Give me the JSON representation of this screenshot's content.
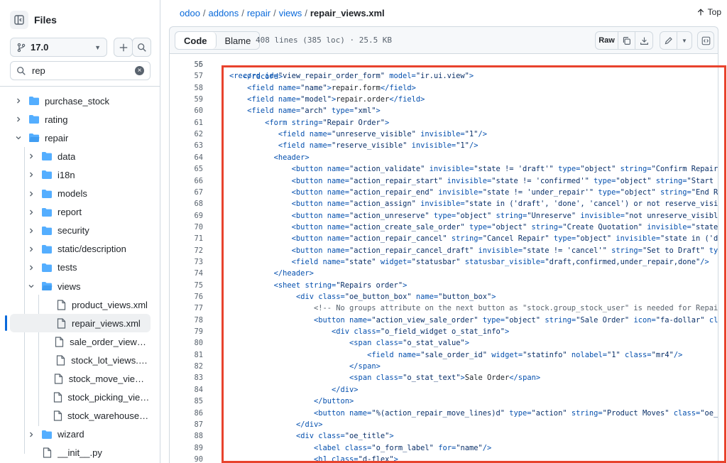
{
  "sidebar": {
    "title": "Files",
    "branch": "17.0",
    "search_value": "rep",
    "tree": [
      {
        "label": "purchase_stock",
        "type": "folder",
        "expanded": false,
        "depth": 0
      },
      {
        "label": "rating",
        "type": "folder",
        "expanded": false,
        "depth": 0
      },
      {
        "label": "repair",
        "type": "folder",
        "expanded": true,
        "depth": 0
      },
      {
        "label": "data",
        "type": "folder",
        "expanded": false,
        "depth": 1
      },
      {
        "label": "i18n",
        "type": "folder",
        "expanded": false,
        "depth": 1
      },
      {
        "label": "models",
        "type": "folder",
        "expanded": false,
        "depth": 1
      },
      {
        "label": "report",
        "type": "folder",
        "expanded": false,
        "depth": 1
      },
      {
        "label": "security",
        "type": "folder",
        "expanded": false,
        "depth": 1
      },
      {
        "label": "static/description",
        "type": "folder",
        "expanded": false,
        "depth": 1
      },
      {
        "label": "tests",
        "type": "folder",
        "expanded": false,
        "depth": 1
      },
      {
        "label": "views",
        "type": "folder",
        "expanded": true,
        "depth": 1
      },
      {
        "label": "product_views.xml",
        "type": "file",
        "depth": 2
      },
      {
        "label": "repair_views.xml",
        "type": "file",
        "depth": 2,
        "selected": true
      },
      {
        "label": "sale_order_views.xml",
        "type": "file",
        "depth": 2
      },
      {
        "label": "stock_lot_views.xml",
        "type": "file",
        "depth": 2
      },
      {
        "label": "stock_move_views.xml",
        "type": "file",
        "depth": 2
      },
      {
        "label": "stock_picking_views.xml",
        "type": "file",
        "depth": 2
      },
      {
        "label": "stock_warehouse_view...",
        "type": "file",
        "depth": 2
      },
      {
        "label": "wizard",
        "type": "folder",
        "expanded": false,
        "depth": 1
      },
      {
        "label": "__init__.py",
        "type": "file",
        "depth": 1
      }
    ]
  },
  "breadcrumb": {
    "parts": [
      "odoo",
      "addons",
      "repair",
      "views"
    ],
    "separator": "/",
    "current": "repair_views.xml"
  },
  "top_label": "Top",
  "toolbar": {
    "code_tab": "Code",
    "blame_tab": "Blame",
    "file_meta": "408 lines (385 loc) · 25.5 KB",
    "raw_label": "Raw"
  },
  "code": {
    "partial_top": "</record>",
    "lines": [
      {
        "n": "56",
        "indent": 0,
        "html": ""
      },
      {
        "n": "57",
        "indent": 4,
        "html": "<span class=\"tag\">&lt;record</span> <span class=\"attr\">id=</span><span class=\"str\">\"view_repair_order_form\"</span> <span class=\"attr\">model=</span><span class=\"str\">\"ir.ui.view\"</span><span class=\"tag\">&gt;</span>"
      },
      {
        "n": "58",
        "indent": 8,
        "html": "<span class=\"tag\">&lt;field</span> <span class=\"attr\">name=</span><span class=\"str\">\"name\"</span><span class=\"tag\">&gt;</span>repair.form<span class=\"tag\">&lt;/field&gt;</span>"
      },
      {
        "n": "59",
        "indent": 8,
        "html": "<span class=\"tag\">&lt;field</span> <span class=\"attr\">name=</span><span class=\"str\">\"model\"</span><span class=\"tag\">&gt;</span>repair.order<span class=\"tag\">&lt;/field&gt;</span>"
      },
      {
        "n": "60",
        "indent": 8,
        "html": "<span class=\"tag\">&lt;field</span> <span class=\"attr\">name=</span><span class=\"str\">\"arch\"</span> <span class=\"attr\">type=</span><span class=\"str\">\"xml\"</span><span class=\"tag\">&gt;</span>"
      },
      {
        "n": "61",
        "indent": 12,
        "html": "<span class=\"tag\">&lt;form</span> <span class=\"attr\">string=</span><span class=\"str\">\"Repair Order\"</span><span class=\"tag\">&gt;</span>"
      },
      {
        "n": "62",
        "indent": 15,
        "html": "<span class=\"tag\">&lt;field</span> <span class=\"attr\">name=</span><span class=\"str\">\"unreserve_visible\"</span> <span class=\"attr\">invisible=</span><span class=\"str\">\"1\"</span><span class=\"tag\">/&gt;</span>"
      },
      {
        "n": "63",
        "indent": 15,
        "html": "<span class=\"tag\">&lt;field</span> <span class=\"attr\">name=</span><span class=\"str\">\"reserve_visible\"</span> <span class=\"attr\">invisible=</span><span class=\"str\">\"1\"</span><span class=\"tag\">/&gt;</span>"
      },
      {
        "n": "64",
        "indent": 14,
        "html": "<span class=\"tag\">&lt;header&gt;</span>"
      },
      {
        "n": "65",
        "indent": 18,
        "html": "<span class=\"tag\">&lt;button</span> <span class=\"attr\">name=</span><span class=\"str\">\"action_validate\"</span> <span class=\"attr\">invisible=</span><span class=\"str\">\"state != 'draft'\"</span> <span class=\"attr\">type=</span><span class=\"str\">\"object\"</span> <span class=\"attr\">string=</span><span class=\"str\">\"Confirm Repair\"</span> c"
      },
      {
        "n": "66",
        "indent": 18,
        "html": "<span class=\"tag\">&lt;button</span> <span class=\"attr\">name=</span><span class=\"str\">\"action_repair_start\"</span> <span class=\"attr\">invisible=</span><span class=\"str\">\"state != 'confirmed'\"</span> <span class=\"attr\">type=</span><span class=\"str\">\"object\"</span> <span class=\"attr\">string=</span><span class=\"str\">\"Start Rep</span>"
      },
      {
        "n": "67",
        "indent": 18,
        "html": "<span class=\"tag\">&lt;button</span> <span class=\"attr\">name=</span><span class=\"str\">\"action_repair_end\"</span> <span class=\"attr\">invisible=</span><span class=\"str\">\"state != 'under_repair'\"</span> <span class=\"attr\">type=</span><span class=\"str\">\"object\"</span> <span class=\"attr\">string=</span><span class=\"str\">\"End Repa</span>"
      },
      {
        "n": "68",
        "indent": 18,
        "html": "<span class=\"tag\">&lt;button</span> <span class=\"attr\">name=</span><span class=\"str\">\"action_assign\"</span> <span class=\"attr\">invisible=</span><span class=\"str\">\"state in ('draft', 'done', 'cancel') or not reserve_visible</span>"
      },
      {
        "n": "69",
        "indent": 18,
        "html": "<span class=\"tag\">&lt;button</span> <span class=\"attr\">name=</span><span class=\"str\">\"action_unreserve\"</span> <span class=\"attr\">type=</span><span class=\"str\">\"object\"</span> <span class=\"attr\">string=</span><span class=\"str\">\"Unreserve\"</span> <span class=\"attr\">invisible=</span><span class=\"str\">\"not unreserve_visible\"</span>"
      },
      {
        "n": "70",
        "indent": 18,
        "html": "<span class=\"tag\">&lt;button</span> <span class=\"attr\">name=</span><span class=\"str\">\"action_create_sale_order\"</span> <span class=\"attr\">type=</span><span class=\"str\">\"object\"</span> <span class=\"attr\">string=</span><span class=\"str\">\"Create Quotation\"</span> <span class=\"attr\">invisible=</span><span class=\"str\">\"state ==</span>"
      },
      {
        "n": "71",
        "indent": 18,
        "html": "<span class=\"tag\">&lt;button</span> <span class=\"attr\">name=</span><span class=\"str\">\"action_repair_cancel\"</span> <span class=\"attr\">string=</span><span class=\"str\">\"Cancel Repair\"</span> <span class=\"attr\">type=</span><span class=\"str\">\"object\"</span> <span class=\"attr\">invisible=</span><span class=\"str\">\"state in ('done</span>"
      },
      {
        "n": "72",
        "indent": 18,
        "html": "<span class=\"tag\">&lt;button</span> <span class=\"attr\">name=</span><span class=\"str\">\"action_repair_cancel_draft\"</span> <span class=\"attr\">invisible=</span><span class=\"str\">\"state != 'cancel'\"</span> <span class=\"attr\">string=</span><span class=\"str\">\"Set to Draft\"</span> <span class=\"attr\">type=</span>"
      },
      {
        "n": "73",
        "indent": 18,
        "html": "<span class=\"tag\">&lt;field</span> <span class=\"attr\">name=</span><span class=\"str\">\"state\"</span> <span class=\"attr\">widget=</span><span class=\"str\">\"statusbar\"</span> <span class=\"attr\">statusbar_visible=</span><span class=\"str\">\"draft,confirmed,under_repair,done\"</span><span class=\"tag\">/&gt;</span>"
      },
      {
        "n": "74",
        "indent": 14,
        "html": "<span class=\"tag\">&lt;/header&gt;</span>"
      },
      {
        "n": "75",
        "indent": 14,
        "html": "<span class=\"tag\">&lt;sheet</span> <span class=\"attr\">string=</span><span class=\"str\">\"Repairs order\"</span><span class=\"tag\">&gt;</span>"
      },
      {
        "n": "76",
        "indent": 19,
        "html": "<span class=\"tag\">&lt;div</span> <span class=\"attr\">class=</span><span class=\"str\">\"oe_button_box\"</span> <span class=\"attr\">name=</span><span class=\"str\">\"button_box\"</span><span class=\"tag\">&gt;</span>"
      },
      {
        "n": "77",
        "indent": 23,
        "html": "<span class=\"cmt\">&lt;!-- No groups attribute on the next button as \"stock.group_stock_user\" is needed for Repair,</span>"
      },
      {
        "n": "78",
        "indent": 23,
        "html": "<span class=\"tag\">&lt;button</span> <span class=\"attr\">name=</span><span class=\"str\">\"action_view_sale_order\"</span> <span class=\"attr\">type=</span><span class=\"str\">\"object\"</span> <span class=\"attr\">string=</span><span class=\"str\">\"Sale Order\"</span> <span class=\"attr\">icon=</span><span class=\"str\">\"fa-dollar\"</span> <span class=\"attr\">class</span>"
      },
      {
        "n": "79",
        "indent": 27,
        "html": "<span class=\"tag\">&lt;div</span> <span class=\"attr\">class=</span><span class=\"str\">\"o_field_widget o_stat_info\"</span><span class=\"tag\">&gt;</span>"
      },
      {
        "n": "80",
        "indent": 31,
        "html": "<span class=\"tag\">&lt;span</span> <span class=\"attr\">class=</span><span class=\"str\">\"o_stat_value\"</span><span class=\"tag\">&gt;</span>"
      },
      {
        "n": "81",
        "indent": 35,
        "html": "<span class=\"tag\">&lt;field</span> <span class=\"attr\">name=</span><span class=\"str\">\"sale_order_id\"</span> <span class=\"attr\">widget=</span><span class=\"str\">\"statinfo\"</span> <span class=\"attr\">nolabel=</span><span class=\"str\">\"1\"</span> <span class=\"attr\">class=</span><span class=\"str\">\"mr4\"</span><span class=\"tag\">/&gt;</span>"
      },
      {
        "n": "82",
        "indent": 31,
        "html": "<span class=\"tag\">&lt;/span&gt;</span>"
      },
      {
        "n": "83",
        "indent": 31,
        "html": "<span class=\"tag\">&lt;span</span> <span class=\"attr\">class=</span><span class=\"str\">\"o_stat_text\"</span><span class=\"tag\">&gt;</span>Sale Order<span class=\"tag\">&lt;/span&gt;</span>"
      },
      {
        "n": "84",
        "indent": 27,
        "html": "<span class=\"tag\">&lt;/div&gt;</span>"
      },
      {
        "n": "85",
        "indent": 23,
        "html": "<span class=\"tag\">&lt;/button&gt;</span>"
      },
      {
        "n": "86",
        "indent": 23,
        "html": "<span class=\"tag\">&lt;button</span> <span class=\"attr\">name=</span><span class=\"str\">\"%(action_repair_move_lines)d\"</span> <span class=\"attr\">type=</span><span class=\"str\">\"action\"</span> <span class=\"attr\">string=</span><span class=\"str\">\"Product Moves\"</span> <span class=\"attr\">class=</span><span class=\"str\">\"oe_sta</span>"
      },
      {
        "n": "87",
        "indent": 19,
        "html": "<span class=\"tag\">&lt;/div&gt;</span>"
      },
      {
        "n": "88",
        "indent": 19,
        "html": "<span class=\"tag\">&lt;div</span> <span class=\"attr\">class=</span><span class=\"str\">\"oe_title\"</span><span class=\"tag\">&gt;</span>"
      },
      {
        "n": "89",
        "indent": 23,
        "html": "<span class=\"tag\">&lt;label</span> <span class=\"attr\">class=</span><span class=\"str\">\"o_form_label\"</span> <span class=\"attr\">for=</span><span class=\"str\">\"name\"</span><span class=\"tag\">/&gt;</span>"
      },
      {
        "n": "90",
        "indent": 23,
        "html": "<span class=\"tag\">&lt;h1</span> <span class=\"attr\">class=</span><span class=\"str\">\"d-flex\"</span><span class=\"tag\">&gt;</span>"
      }
    ]
  },
  "colors": {
    "accent": "#0969da",
    "highlight_box": "#e8432d",
    "folder": "#54aeff"
  }
}
